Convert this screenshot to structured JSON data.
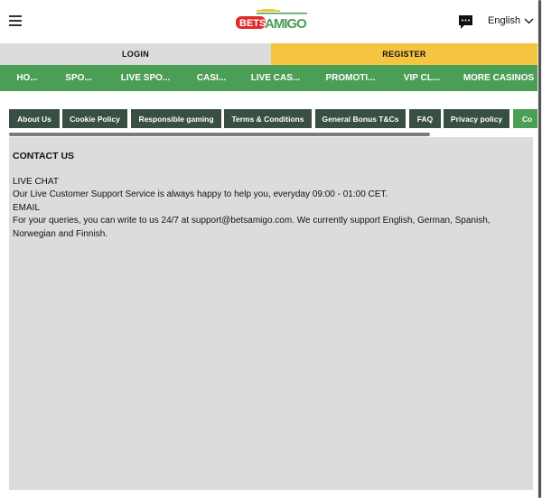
{
  "header": {
    "logo_text": "BETSAMIGO",
    "logo_part1": "BETS",
    "logo_part2": "AMIGO",
    "language": "English",
    "icons": [
      "hamburger-menu-icon",
      "chat-icon",
      "chevron-down-icon"
    ]
  },
  "auth": {
    "login": "LOGIN",
    "register": "REGISTER"
  },
  "nav": [
    "HO...",
    "SPO...",
    "LIVE SPO...",
    "CASI...",
    "LIVE CAS...",
    "PROMOTI...",
    "VIP CL...",
    "MORE CASINOS"
  ],
  "tabs": [
    "About Us",
    "Cookie Policy",
    "Responsible gaming",
    "Terms & Conditions",
    "General Bonus T&Cs",
    "FAQ",
    "Privacy policy",
    "Co"
  ],
  "content": {
    "title": "CONTACT US",
    "lines": [
      "LIVE CHAT",
      "Our Live Customer Support Service is always happy to help you, everyday 09:00 - 01:00 CET.",
      "EMAIL",
      "For your queries, you can write to us 24/7 at support@betsamigo.com. We currently support English, German, Spanish, Norwegian and Finnish."
    ]
  },
  "colors": {
    "green": "#4a9e55",
    "yellow": "#f5c542",
    "dark_tab": "#3a4f44",
    "logo_red": "#e02b2b"
  }
}
